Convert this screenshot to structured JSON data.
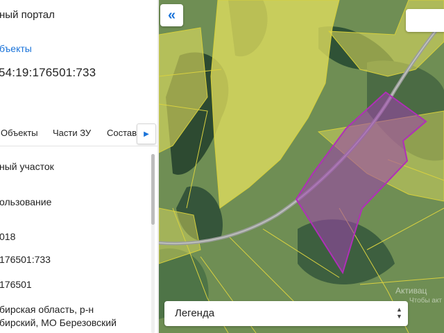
{
  "panel": {
    "portal_title": "ный портал",
    "objects_link": "бъекты",
    "cadastral_number": "54:19:176501:733",
    "tabs": [
      "Объекты",
      "Части ЗУ",
      "Состав"
    ],
    "rows": {
      "type": "ный участок",
      "usage": "ользование",
      "date": "018",
      "cad": "176501:733",
      "quarter": "176501",
      "address_line1": "бирская область, р-н",
      "address_line2": "бирский, МО Березовский"
    }
  },
  "map": {
    "legend_label": "Легенда",
    "watermark": "Активац",
    "watermark2": "Чтобы акт"
  },
  "colors": {
    "accent": "#1a73d9",
    "parcel_fill": "#e3e065",
    "selected_parcel": "#b02fb8"
  },
  "icons": {
    "collapse": "double-chevron-left-icon",
    "tab_next": "triangle-right-icon",
    "legend_toggle": "up-down-arrows-icon"
  }
}
